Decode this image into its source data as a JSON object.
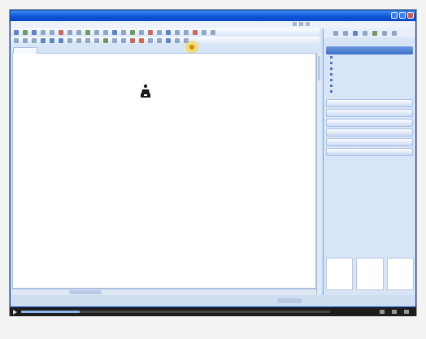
{
  "window": {
    "title": "",
    "accent": "#0f55d8"
  },
  "menu": {
    "items": [
      "",
      "",
      "",
      "",
      "",
      "",
      "",
      "",
      ""
    ]
  },
  "document": {
    "tab_label": ""
  },
  "task_pane": {
    "title": "",
    "sections": [
      {
        "header": "",
        "links": [
          "",
          "",
          "",
          "",
          "",
          "",
          ""
        ]
      },
      {
        "header": ""
      },
      {
        "header": ""
      },
      {
        "header": ""
      },
      {
        "header": ""
      },
      {
        "header": ""
      },
      {
        "header": ""
      }
    ]
  },
  "status_bar": {
    "text": ""
  },
  "player": {
    "progress": 0.19,
    "time": ""
  },
  "caption": "",
  "icons": [
    "person-icon",
    "play-icon",
    "volume-icon",
    "fullscreen-icon",
    "close-icon",
    "minimize-icon",
    "maximize-icon"
  ]
}
